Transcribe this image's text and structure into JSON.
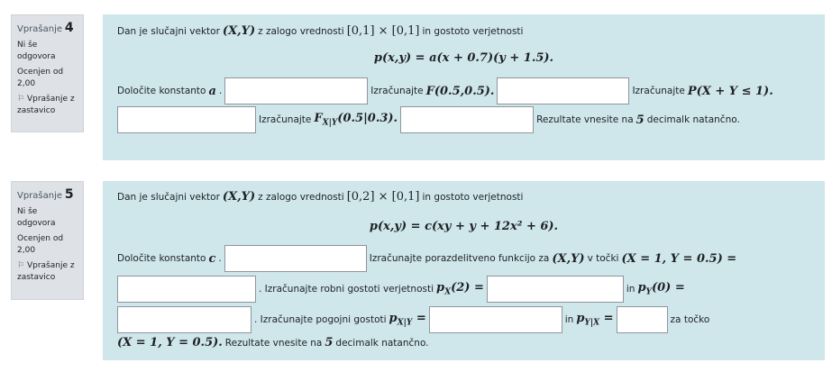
{
  "q4": {
    "label": "Vprašanje",
    "number": "4",
    "status": "Ni še odgovora",
    "grade": "Ocenjen od 2,00",
    "flag": "Vprašanje z zastavico",
    "intro1": "Dan je slučajni vektor",
    "vec": "(X,Y)",
    "intro2": "z zalogo vrednosti",
    "range": "[0,1] × [0,1]",
    "intro3": "in gostoto verjetnosti",
    "formula": "p(x,y) = a(x + 0.7)(y + 1.5).",
    "t1": "Določite konstanto",
    "t1m": "a",
    "t2": "Izračunajte",
    "t2m": "F(0.5,0.5).",
    "t3": "Izračunajte",
    "t3m": "P(X + Y ≤ 1).",
    "t4": "Izračunajte",
    "t4m": "F",
    "t4sub": "X|Y",
    "t4m2": "(0.5|0.3).",
    "t5": "Rezultate vnesite na",
    "t5m": "5",
    "t5b": "decimalk natančno."
  },
  "q5": {
    "label": "Vprašanje",
    "number": "5",
    "status": "Ni še odgovora",
    "grade": "Ocenjen od 2,00",
    "flag": "Vprašanje z zastavico",
    "intro1": "Dan je slučajni vektor",
    "vec": "(X,Y)",
    "intro2": "z zalogo vrednosti",
    "range": "[0,2] × [0,1]",
    "intro3": "in gostoto verjetnosti",
    "formula": "p(x,y) = c(xy + y + 12x² + 6).",
    "t1": "Določite konstanto",
    "t1m": "c",
    "t2": "Izračunajte porazdelitveno funkcijo za",
    "t2m": "(X,Y)",
    "t2b": "v točki",
    "t2m2": "(X = 1, Y = 0.5) =",
    "t3": ". Izračunajte robni gostoti verjetnosti",
    "t3m": "p",
    "t3sub": "X",
    "t3m2": "(2) =",
    "t3b": "in",
    "t3m3": "p",
    "t3sub2": "Y",
    "t3m4": "(0) =",
    "t4": ". Izračunajte pogojni gostoti",
    "t4m": "p",
    "t4sub": "X|Y",
    "t4m2": "=",
    "t4b": "in",
    "t4m3": "p",
    "t4sub2": "Y|X",
    "t4m4": "=",
    "t4c": "za točko",
    "t5m": "(X = 1, Y = 0.5).",
    "t5": "Rezultate vnesite na",
    "t5n": "5",
    "t5b": "decimalk natančno."
  }
}
